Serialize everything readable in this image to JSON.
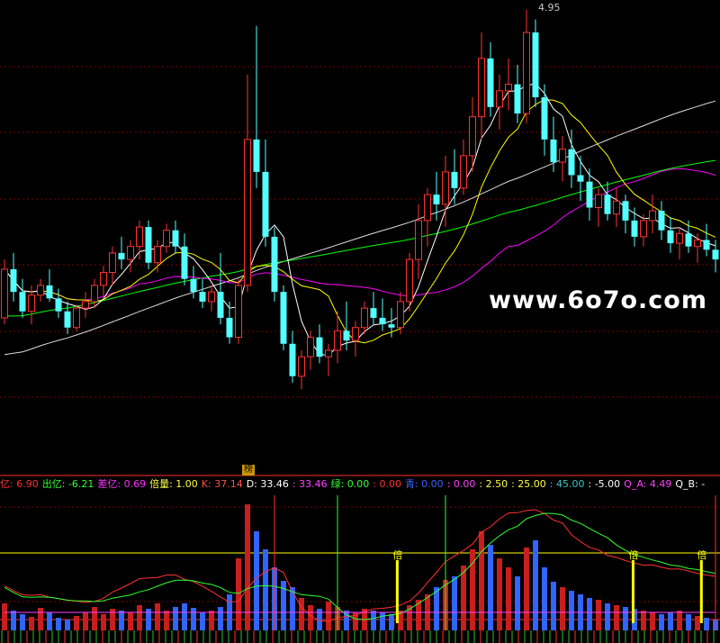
{
  "watermark": "www.6o7o.com",
  "peak_label": "4.95",
  "bang_label": "榜",
  "indicator_items": [
    {
      "label": "亿:",
      "value": "6.90",
      "color": "#ff3030"
    },
    {
      "label": "出亿:",
      "value": "-6.21",
      "color": "#30ff30"
    },
    {
      "label": "差亿:",
      "value": "0.69",
      "color": "#ff30ff"
    },
    {
      "label": "倍量:",
      "value": "1.00",
      "color": "#ffff40"
    },
    {
      "label": "K:",
      "value": "37.14",
      "color": "#ff5050"
    },
    {
      "label": "D:",
      "value": "33.46",
      "color": "#ffffff"
    },
    {
      "label": ":",
      "value": "33.46",
      "color": "#ff40ff"
    },
    {
      "label": "绿:",
      "value": "0.00",
      "color": "#30ff30"
    },
    {
      "label": ":",
      "value": "0.00",
      "color": "#ff3030"
    },
    {
      "label": "青:",
      "value": "0.00",
      "color": "#4060ff"
    },
    {
      "label": ":",
      "value": "0.00",
      "color": "#ff40ff"
    },
    {
      "label": ":",
      "value": "2.50",
      "color": "#ffff40"
    },
    {
      "label": ":",
      "value": "25.00",
      "color": "#ffff40"
    },
    {
      "label": ":",
      "value": "45.00",
      "color": "#40c0c0"
    },
    {
      "label": ":",
      "value": "-5.00",
      "color": "#ffffff"
    },
    {
      "label": "Q_A:",
      "value": "4.49",
      "color": "#ff40ff"
    },
    {
      "label": "Q_B:",
      "value": "-",
      "color": "#ffffff"
    }
  ],
  "multiplier_marks": [
    {
      "label": "倍",
      "index": 64
    },
    {
      "label": "倍",
      "index": 102
    },
    {
      "label": "倍",
      "index": 113
    }
  ],
  "colors": {
    "up": "#ff3232",
    "down": "#54ffff",
    "ma_short": "#ffffff",
    "ma_mid": "#ffff00",
    "ma_long1": "#ff00ff",
    "ma_long2": "#00ff00",
    "ma_long3": "#dcdcdc",
    "vol_up": "#c81e1e",
    "vol_down": "#3264ff",
    "grid": "#800000"
  },
  "chart_data": {
    "type": "candlestick",
    "candles": [
      [
        4.0,
        4.18,
        3.98,
        4.15
      ],
      [
        4.15,
        4.2,
        4.05,
        4.08
      ],
      [
        4.08,
        4.12,
        4.0,
        4.02
      ],
      [
        4.02,
        4.1,
        3.98,
        4.07
      ],
      [
        4.07,
        4.12,
        4.05,
        4.1
      ],
      [
        4.1,
        4.15,
        4.05,
        4.06
      ],
      [
        4.06,
        4.09,
        4.0,
        4.02
      ],
      [
        4.02,
        4.05,
        3.95,
        3.97
      ],
      [
        3.97,
        4.04,
        3.96,
        4.03
      ],
      [
        4.03,
        4.08,
        4.0,
        4.05
      ],
      [
        4.05,
        4.12,
        4.03,
        4.1
      ],
      [
        4.1,
        4.16,
        4.06,
        4.14
      ],
      [
        4.14,
        4.22,
        4.1,
        4.2
      ],
      [
        4.2,
        4.25,
        4.15,
        4.18
      ],
      [
        4.18,
        4.24,
        4.14,
        4.22
      ],
      [
        4.22,
        4.3,
        4.18,
        4.28
      ],
      [
        4.28,
        4.3,
        4.15,
        4.17
      ],
      [
        4.17,
        4.24,
        4.14,
        4.22
      ],
      [
        4.22,
        4.29,
        4.2,
        4.27
      ],
      [
        4.27,
        4.3,
        4.2,
        4.22
      ],
      [
        4.22,
        4.26,
        4.1,
        4.12
      ],
      [
        4.12,
        4.16,
        4.06,
        4.08
      ],
      [
        4.08,
        4.12,
        4.03,
        4.05
      ],
      [
        4.05,
        4.1,
        4.02,
        4.08
      ],
      [
        4.08,
        4.2,
        3.98,
        4.0
      ],
      [
        4.0,
        4.05,
        3.92,
        3.94
      ],
      [
        3.94,
        4.12,
        3.92,
        4.1
      ],
      [
        4.1,
        4.75,
        4.08,
        4.55
      ],
      [
        4.55,
        4.9,
        4.4,
        4.45
      ],
      [
        4.45,
        4.55,
        4.22,
        4.25
      ],
      [
        4.25,
        4.28,
        4.05,
        4.08
      ],
      [
        4.08,
        4.1,
        3.9,
        3.92
      ],
      [
        3.92,
        3.96,
        3.8,
        3.82
      ],
      [
        3.82,
        3.9,
        3.78,
        3.88
      ],
      [
        3.88,
        3.96,
        3.84,
        3.94
      ],
      [
        3.94,
        3.98,
        3.86,
        3.88
      ],
      [
        3.88,
        3.92,
        3.82,
        3.9
      ],
      [
        3.9,
        4.02,
        3.86,
        3.96
      ],
      [
        3.96,
        4.05,
        3.9,
        3.93
      ],
      [
        3.93,
        3.99,
        3.88,
        3.97
      ],
      [
        3.97,
        4.05,
        3.95,
        4.03
      ],
      [
        4.03,
        4.08,
        3.98,
        4.0
      ],
      [
        4.0,
        4.06,
        3.96,
        3.98
      ],
      [
        3.98,
        4.03,
        3.94,
        3.97
      ],
      [
        3.97,
        4.08,
        3.95,
        4.05
      ],
      [
        4.05,
        4.2,
        4.02,
        4.18
      ],
      [
        4.18,
        4.35,
        4.12,
        4.3
      ],
      [
        4.3,
        4.4,
        4.22,
        4.38
      ],
      [
        4.38,
        4.45,
        4.3,
        4.35
      ],
      [
        4.35,
        4.5,
        4.28,
        4.45
      ],
      [
        4.45,
        4.52,
        4.35,
        4.4
      ],
      [
        4.4,
        4.55,
        4.38,
        4.5
      ],
      [
        4.5,
        4.68,
        4.45,
        4.62
      ],
      [
        4.62,
        4.88,
        4.55,
        4.8
      ],
      [
        4.8,
        4.85,
        4.62,
        4.65
      ],
      [
        4.65,
        4.75,
        4.58,
        4.7
      ],
      [
        4.7,
        4.8,
        4.64,
        4.72
      ],
      [
        4.72,
        4.78,
        4.6,
        4.63
      ],
      [
        4.63,
        4.95,
        4.6,
        4.88
      ],
      [
        4.88,
        4.92,
        4.65,
        4.68
      ],
      [
        4.68,
        4.72,
        4.5,
        4.55
      ],
      [
        4.55,
        4.62,
        4.45,
        4.48
      ],
      [
        4.48,
        4.56,
        4.42,
        4.52
      ],
      [
        4.52,
        4.58,
        4.4,
        4.44
      ],
      [
        4.44,
        4.5,
        4.36,
        4.42
      ],
      [
        4.42,
        4.46,
        4.3,
        4.34
      ],
      [
        4.34,
        4.4,
        4.28,
        4.38
      ],
      [
        4.38,
        4.42,
        4.3,
        4.32
      ],
      [
        4.32,
        4.4,
        4.28,
        4.36
      ],
      [
        4.36,
        4.38,
        4.26,
        4.3
      ],
      [
        4.3,
        4.34,
        4.22,
        4.25
      ],
      [
        4.25,
        4.32,
        4.22,
        4.3
      ],
      [
        4.3,
        4.38,
        4.26,
        4.33
      ],
      [
        4.33,
        4.36,
        4.24,
        4.27
      ],
      [
        4.27,
        4.31,
        4.2,
        4.23
      ],
      [
        4.23,
        4.28,
        4.18,
        4.26
      ],
      [
        4.26,
        4.3,
        4.2,
        4.22
      ],
      [
        4.22,
        4.26,
        4.17,
        4.24
      ],
      [
        4.24,
        4.29,
        4.19,
        4.21
      ],
      [
        4.21,
        4.24,
        4.14,
        4.18
      ]
    ],
    "ylim": [
      3.55,
      4.98
    ],
    "volumes": [
      30,
      22,
      18,
      15,
      25,
      20,
      14,
      12,
      16,
      20,
      26,
      18,
      24,
      22,
      20,
      28,
      24,
      30,
      22,
      26,
      30,
      25,
      20,
      22,
      26,
      40,
      80,
      140,
      110,
      90,
      70,
      55,
      48,
      36,
      28,
      24,
      32,
      26,
      22,
      20,
      24,
      22,
      20,
      18,
      22,
      28,
      34,
      40,
      48,
      56,
      60,
      72,
      90,
      110,
      95,
      80,
      70,
      60,
      92,
      100,
      70,
      54,
      48,
      44,
      40,
      36,
      34,
      30,
      28,
      26,
      24,
      22,
      20,
      18,
      20,
      22,
      18,
      16,
      14,
      12
    ],
    "vol_ylim": [
      0,
      150
    ]
  }
}
